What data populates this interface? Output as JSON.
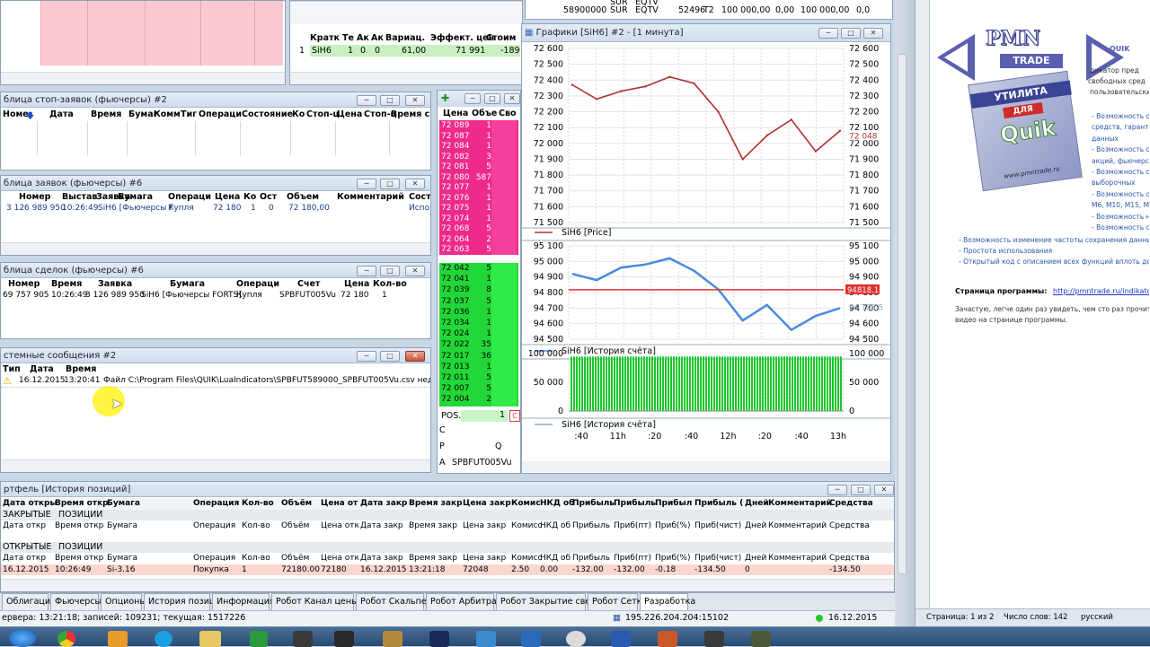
{
  "top_left_window": {
    "labels": [
      "—",
      "—",
      "—",
      "—"
    ]
  },
  "summary_panel": {
    "headers": [
      "Кратк",
      "Те",
      "Ак",
      "Ак",
      "Вариац.",
      "Эффект. цен",
      "Стоим"
    ],
    "row": [
      "1",
      "SiH6",
      "1",
      "0",
      "0",
      "61,00",
      "71 991",
      "-189"
    ]
  },
  "top_right_strip": {
    "row1": [
      "",
      "SUR",
      "EQTV",
      "",
      "",
      "",
      "",
      ""
    ],
    "row2": [
      "58900000",
      "SUR",
      "EQTV",
      "52496",
      "T2",
      "100 000,00",
      "0,00",
      "100 000,00",
      "0,0"
    ]
  },
  "stop_orders": {
    "title": "блица стоп-заявок (фьючерсы) #2",
    "headers": [
      "Номе",
      "Дата",
      "Время",
      "Бумаг",
      "Комм",
      "Тиг",
      "Операци",
      "Состояние",
      "Ко",
      "Стоп-ц",
      "Цена",
      "Стоп-ц",
      "Время сі"
    ]
  },
  "orders": {
    "title": "блица заявок (фьючерсы) #6",
    "headers": [
      "Номер",
      "Выстав",
      "Заявка",
      "Бумага",
      "Операци",
      "Цена",
      "Ко",
      "Ост",
      "Объем",
      "Комментарий",
      "Сост"
    ],
    "row": [
      "3 126 989 950",
      "10:26:49",
      "SiH6 [Фьючерсы F",
      "Купля",
      "72 180",
      "1",
      "0",
      "72 180,00",
      "Испо"
    ]
  },
  "trades": {
    "title": "блица сделок (фьючерсы) #6",
    "headers": [
      "Номер",
      "Время",
      "Заявка",
      "Бумага",
      "Операци",
      "Счет",
      "Цена",
      "Кол-во"
    ],
    "row": [
      "69 757 905",
      "10:26:49",
      "3 126 989 950",
      "SiH6 [Фьючерсы FORTS]",
      "Купля",
      "SPBFUT005Vu",
      "72 180",
      "1"
    ]
  },
  "messages": {
    "title": "стемные сообщения #2",
    "headers": [
      "Тип",
      "Дата",
      "Время"
    ],
    "row": {
      "date": "16.12.2015",
      "time": "13:20:41",
      "text": "Файл C:\\Program Files\\QUIK\\LuaIndicators\\SPBFUT589000_SPBFUT005Vu.csv недоступ"
    }
  },
  "orderbook": {
    "headers": [
      "Цена",
      "Объе",
      "Сво"
    ],
    "asks": [
      [
        "72 089",
        "1"
      ],
      [
        "72 087",
        "1"
      ],
      [
        "72 084",
        "1"
      ],
      [
        "72 082",
        "3"
      ],
      [
        "72 081",
        "5"
      ],
      [
        "72 080",
        "587"
      ],
      [
        "72 077",
        "1"
      ],
      [
        "72 076",
        "1"
      ],
      [
        "72 075",
        "1"
      ],
      [
        "72 074",
        "1"
      ],
      [
        "72 068",
        "5"
      ],
      [
        "72 064",
        "2"
      ],
      [
        "72 063",
        "5"
      ]
    ],
    "bids": [
      [
        "72 042",
        "5"
      ],
      [
        "72 041",
        "1"
      ],
      [
        "72 039",
        "8"
      ],
      [
        "72 037",
        "5"
      ],
      [
        "72 036",
        "1"
      ],
      [
        "72 034",
        "1"
      ],
      [
        "72 024",
        "1"
      ],
      [
        "72 022",
        "35"
      ],
      [
        "72 017",
        "36"
      ],
      [
        "72 013",
        "1"
      ],
      [
        "72 011",
        "5"
      ],
      [
        "72 007",
        "5"
      ],
      [
        "72 004",
        "2"
      ]
    ],
    "pos_label": "POS.",
    "pos_value": "1",
    "c_label": "C",
    "p_label": "P",
    "q_label": "Q",
    "a_label": "A",
    "account": "SPBFUT005Vu"
  },
  "chart_window": {
    "title": "Графики [SiH6] #2 - [1 минута]",
    "price_legend": "SiH6 [Price]",
    "equity_legend": "SiH6 [История счёта]",
    "volume_legend": "SiH6 [История счёта]",
    "price_ticks": [
      "72 600",
      "72 500",
      "72 400",
      "72 300",
      "72 200",
      "72 100",
      "72 000",
      "71 900",
      "71 800",
      "71 700",
      "71 600",
      "71 500"
    ],
    "current_price": "72 048",
    "equity_ticks": [
      "95 100",
      "95 000",
      "94 900",
      "94 800",
      "94 700",
      "94 600",
      "94 500"
    ],
    "equity_marker": "94818.1",
    "equity_marker2": "94 705,5",
    "volume_ticks": [
      "100 000",
      "50 000",
      "0"
    ],
    "time_ticks": [
      ":40",
      "11h",
      ":20",
      ":40",
      "12h",
      ":20",
      ":40",
      "13h"
    ]
  },
  "chart_data": [
    {
      "type": "line",
      "title": "Графики [SiH6] #2 - [1 минута]",
      "series": [
        {
          "name": "SiH6 [Price]",
          "x": [
            "10:20",
            "10:40",
            "11:00",
            "11:20",
            "11:40",
            "12:00",
            "12:10",
            "12:20",
            "12:40",
            "12:50",
            "13:00",
            "13:20"
          ],
          "values": [
            72370,
            72280,
            72330,
            72360,
            72420,
            72380,
            72200,
            71900,
            72050,
            72150,
            71950,
            72080
          ]
        }
      ],
      "ylim": [
        71500,
        72600
      ]
    },
    {
      "type": "line",
      "series": [
        {
          "name": "SiH6 [История счёта]",
          "x": [
            "10:20",
            "10:40",
            "11:00",
            "11:20",
            "11:40",
            "12:00",
            "12:10",
            "12:20",
            "12:40",
            "12:50",
            "13:00",
            "13:20"
          ],
          "values": [
            94920,
            94880,
            94960,
            94980,
            95020,
            94940,
            94820,
            94620,
            94720,
            94560,
            94650,
            94700
          ]
        }
      ],
      "ylim": [
        94500,
        95100
      ]
    },
    {
      "type": "bar",
      "series": [
        {
          "name": "SiH6 [История счёта]",
          "values": [
            94818
          ]
        }
      ],
      "ylim": [
        0,
        100000
      ]
    }
  ],
  "portfolio": {
    "title": "ртфель [История позиций]",
    "headers": [
      "Дата откры",
      "Время откр",
      "Бумага",
      "Операция",
      "Кол-во",
      "Объём",
      "Цена от",
      "Дата закр",
      "Время закр",
      "Цена закр",
      "Комис",
      "НКД об",
      "Прибыль",
      "Прибыль",
      "Прибыл",
      "Прибыль (",
      "Дней",
      "Комментарий",
      "Средства"
    ],
    "closed_label": [
      "ЗАКРЫТЫЕ",
      "ПОЗИЦИИ"
    ],
    "closed_sub": [
      "Дата откр",
      "Время откр",
      "Бумага",
      "Операция",
      "Кол-во",
      "Объём",
      "Цена отк",
      "Дата закр",
      "Время закр",
      "Цена закр",
      "Комисс",
      "НКД об",
      "Прибыль",
      "Приб(пт)",
      "Приб(%)",
      "Приб(чист)",
      "Дней",
      "Комментарий",
      "Средства"
    ],
    "open_label": [
      "ОТКРЫТЫЕ",
      "ПОЗИЦИИ"
    ],
    "open_sub": [
      "Дата откр",
      "Время откр",
      "Бумага",
      "Операция",
      "Кол-во",
      "Объём",
      "Цена отк",
      "Дата закр",
      "Время закр",
      "Цена закр",
      "Комисс",
      "НКД об",
      "Прибыль",
      "Приб(пт)",
      "Приб(%)",
      "Приб(чист)",
      "Дней",
      "Комментарий",
      "Средства"
    ],
    "row": [
      "16.12.2015",
      "10:26:49",
      "Si-3.16",
      "Покупка",
      "1",
      "72180.00",
      "72180",
      "16.12.2015",
      "13:21:18",
      "72048",
      "2.50",
      "0.00",
      "-132.00",
      "-132.00",
      "-0.18",
      "-134.50",
      "0",
      "",
      "-134.50"
    ]
  },
  "tabs": [
    "Облигации",
    "Фьючерсы",
    "Опционы",
    "История позиций",
    "Информация",
    "Робот Канал цены",
    "Робот Скальпер",
    "Робот Арбитраж",
    "Робот Закрытие свечи",
    "Робот Сетка",
    "Разработка"
  ],
  "status": {
    "left": "ервера: 13:21:18; записей: 109231; текущая: 1517226",
    "ip": "195.226.204.204:15102",
    "date": "16.12.2015"
  },
  "doc": {
    "logo_top": "PMN",
    "logo_trade": "TRADE",
    "box_title": "УТИЛИТА",
    "box_sub": "ДЛЯ",
    "box_brand": "Quik",
    "box_url": "www.pmntrade.ru",
    "right_frag": [
      "QUIK",
      "дикатор пред",
      "свободных сред",
      "пользовательски"
    ],
    "bullets_short": [
      "- Возможность о",
      "средств, гаранти",
      "данных",
      "- Возможность о",
      "акций, фьючерсо",
      "- Возможность о",
      "выборочных",
      "- Возможность о",
      "М6, М10, М15, М",
      "- Возможность н",
      "- Возможность са"
    ],
    "bullets_long": [
      "- Возможность изменение частоты сохранения данных",
      "- Простота использования",
      "- Открытый код с описанием всех функций вплоть до к"
    ],
    "link_label": "Страница программы:",
    "link": "http://pmntrade.ru/indikator_acc",
    "para": "Зачастую, легче один раз увидеть, чем сто раз прочитать",
    "para2": "видео на странице программы.",
    "status_page": "Страница: 1 из 2",
    "status_words": "Число слов: 142",
    "status_lang": "русский"
  }
}
